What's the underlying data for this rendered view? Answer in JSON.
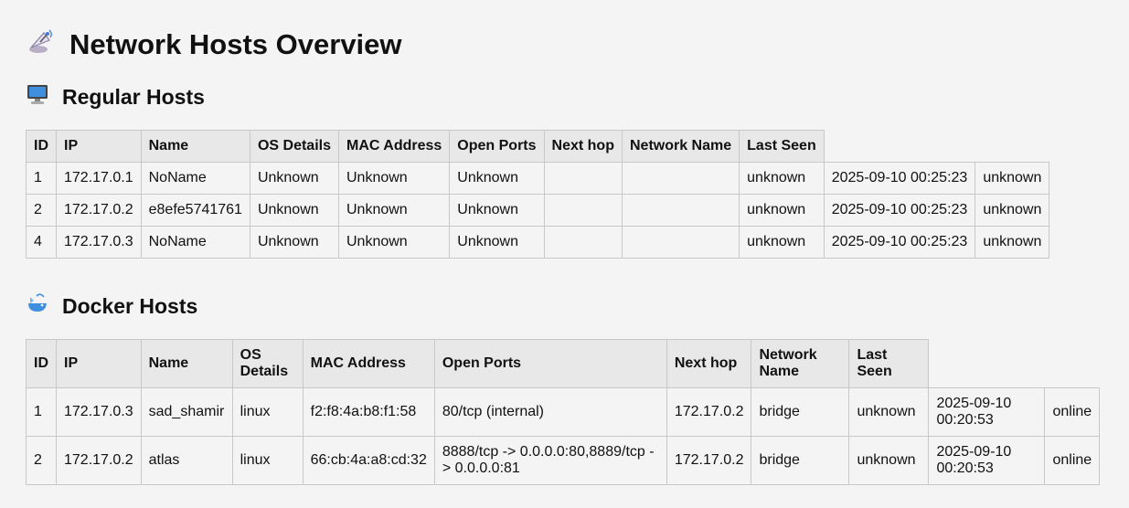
{
  "page": {
    "title": "Network Hosts Overview",
    "title_icon": "satellite-antenna-icon"
  },
  "regular": {
    "heading": "Regular Hosts",
    "icon": "desktop-computer-icon",
    "headers": [
      "ID",
      "IP",
      "Name",
      "OS Details",
      "MAC Address",
      "Open Ports",
      "Next hop",
      "Network Name",
      "Last Seen"
    ],
    "rows": [
      [
        "1",
        "172.17.0.1",
        "NoName",
        "Unknown",
        "Unknown",
        "Unknown",
        "",
        "",
        "unknown",
        "2025-09-10 00:25:23",
        "unknown"
      ],
      [
        "2",
        "172.17.0.2",
        "e8efe5741761",
        "Unknown",
        "Unknown",
        "Unknown",
        "",
        "",
        "unknown",
        "2025-09-10 00:25:23",
        "unknown"
      ],
      [
        "4",
        "172.17.0.3",
        "NoName",
        "Unknown",
        "Unknown",
        "Unknown",
        "",
        "",
        "unknown",
        "2025-09-10 00:25:23",
        "unknown"
      ]
    ]
  },
  "docker": {
    "heading": "Docker Hosts",
    "icon": "whale-icon",
    "headers": [
      "ID",
      "IP",
      "Name",
      "OS Details",
      "MAC Address",
      "Open Ports",
      "Next hop",
      "Network Name",
      "Last Seen"
    ],
    "rows": [
      [
        "1",
        "172.17.0.3",
        "sad_shamir",
        "linux",
        "f2:f8:4a:b8:f1:58",
        "80/tcp (internal)",
        "172.17.0.2",
        "bridge",
        "unknown",
        "2025-09-10 00:20:53",
        "online"
      ],
      [
        "2",
        "172.17.0.2",
        "atlas",
        "linux",
        "66:cb:4a:a8:cd:32",
        "8888/tcp -> 0.0.0.0:80,8889/tcp -> 0.0.0.0:81",
        "172.17.0.2",
        "bridge",
        "unknown",
        "2025-09-10 00:20:53",
        "online"
      ]
    ]
  }
}
